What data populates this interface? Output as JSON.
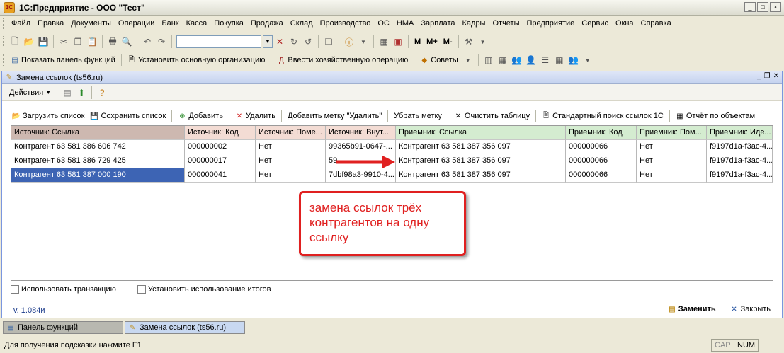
{
  "app": {
    "title": "1С:Предприятие - ООО \"Тест\"",
    "logo": "1С"
  },
  "menu": [
    "Файл",
    "Правка",
    "Документы",
    "Операции",
    "Банк",
    "Касса",
    "Покупка",
    "Продажа",
    "Склад",
    "Производство",
    "ОС",
    "НМА",
    "Зарплата",
    "Кадры",
    "Отчеты",
    "Предприятие",
    "Сервис",
    "Окна",
    "Справка"
  ],
  "toolbar2": {
    "show_panel": "Показать панель функций",
    "set_org": "Установить основную организацию",
    "enter_op": "Ввести хозяйственную операцию",
    "tips": "Советы"
  },
  "toolbar1": {
    "m1": "M",
    "m2": "M+",
    "m3": "M-"
  },
  "doc": {
    "title": "Замена ссылок (ts56.ru)",
    "actions": "Действия",
    "buttons": {
      "load": "Загрузить список",
      "save": "Сохранить список",
      "add": "Добавить",
      "delete": "Удалить",
      "add_mark": "Добавить метку \"Удалить\"",
      "remove_mark": "Убрать метку",
      "clear": "Очистить таблицу",
      "std_search": "Стандартный поиск ссылок 1С",
      "report": "Отчёт по объектам"
    },
    "columns": [
      "Источник: Ссылка",
      "Источник: Код",
      "Источник: Поме...",
      "Источник: Внут...",
      "Приемник: Ссылка",
      "Приемник: Код",
      "Приемник: Пом...",
      "Приемник: Иде..."
    ],
    "rows": [
      [
        "Контрагент 63 581 386 606 742",
        "000000002",
        "Нет",
        "99365b91-0647-...",
        "Контрагент 63 581 387 356 097",
        "000000066",
        "Нет",
        "f9197d1a-f3ac-4..."
      ],
      [
        "Контрагент 63 581 386 729 425",
        "000000017",
        "Нет",
        "59...",
        "Контрагент 63 581 387 356 097",
        "000000066",
        "Нет",
        "f9197d1a-f3ac-4..."
      ],
      [
        "Контрагент 63 581 387 000 190",
        "000000041",
        "Нет",
        "7dbf98a3-9910-4...",
        "Контрагент 63 581 387 356 097",
        "000000066",
        "Нет",
        "f9197d1a-f3ac-4..."
      ]
    ],
    "use_transaction": "Использовать транзакцию",
    "set_totals": "Установить использование итогов",
    "version": "v. 1.084и",
    "replace": "Заменить",
    "close": "Закрыть"
  },
  "annotation": "замена ссылок трёх контрагентов на одну ссылку",
  "tasks": [
    "Панель функций",
    "Замена ссылок (ts56.ru)"
  ],
  "status": {
    "hint": "Для получения подсказки нажмите F1",
    "cap": "CAP",
    "num": "NUM"
  },
  "colors": {
    "selected_row": "#3d64b4",
    "annotation": "#e02020",
    "source_header": "#f3dcd4",
    "dest_header": "#d4ecd0"
  }
}
